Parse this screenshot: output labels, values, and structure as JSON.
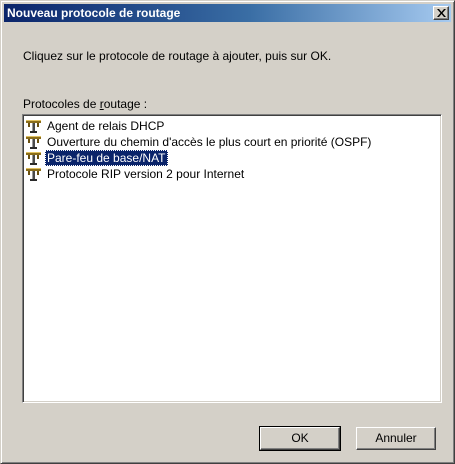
{
  "window": {
    "title": "Nouveau protocole de routage"
  },
  "instruction": "Cliquez sur le protocole de routage à ajouter, puis sur OK.",
  "list_label": {
    "before": "Protocoles de ",
    "accel": "r",
    "after": "outage :"
  },
  "protocols": [
    {
      "label": "Agent de relais DHCP",
      "icon": "routing-protocol-icon",
      "selected": false
    },
    {
      "label": "Ouverture du chemin d'accès le plus court en priorité (OSPF)",
      "icon": "routing-protocol-icon",
      "selected": false
    },
    {
      "label": "Pare-feu de base/NAT",
      "icon": "routing-protocol-icon",
      "selected": true
    },
    {
      "label": "Protocole RIP version 2 pour Internet",
      "icon": "routing-protocol-icon",
      "selected": false
    }
  ],
  "buttons": {
    "ok": "OK",
    "cancel": "Annuler"
  },
  "colors": {
    "selection": "#0a246a",
    "face": "#d4d0c8",
    "title_gradient_start": "#0a246a",
    "title_gradient_end": "#a6caf0"
  }
}
